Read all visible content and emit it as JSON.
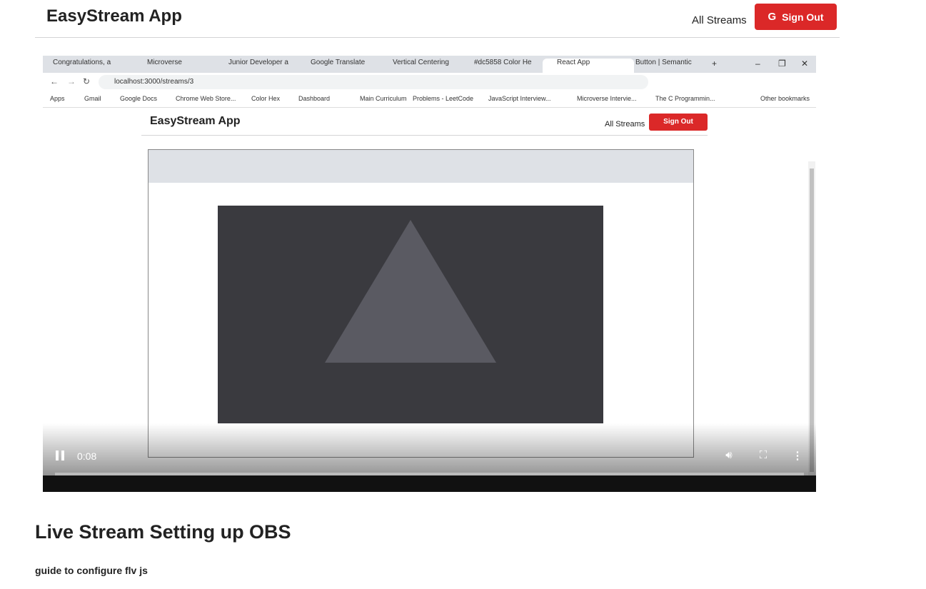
{
  "header": {
    "brand": "EasyStream App",
    "nav_all_streams": "All Streams",
    "sign_out_label": "Sign Out",
    "sign_out_icon": "G"
  },
  "captured_browser": {
    "tabs": [
      {
        "label": "Congratulations, a"
      },
      {
        "label": "Microverse"
      },
      {
        "label": "Junior Developer a"
      },
      {
        "label": "Google Translate"
      },
      {
        "label": "Vertical Centering"
      },
      {
        "label": "#dc5858 Color He"
      },
      {
        "label": "React App"
      },
      {
        "label": "Button | Semantic"
      }
    ],
    "url": "localhost:3000/streams/3",
    "bookmarks": [
      "Apps",
      "Gmail",
      "Google Docs",
      "Chrome Web Store...",
      "Color Hex",
      "Dashboard",
      "Main Curriculum",
      "Problems - LeetCode",
      "JavaScript Interview...",
      "Microverse Intervie...",
      "The C Programmin...",
      "Other bookmarks"
    ],
    "inner_brand": "EasyStream App",
    "inner_all_streams": "All Streams",
    "inner_sign_out": "Sign Out"
  },
  "player": {
    "current_time": "0:08",
    "progress": 0.0,
    "pause_icon": "pause-icon",
    "volume_icon": "volume-icon",
    "fullscreen_icon": "fullscreen-icon",
    "more_icon": "more-vert-icon"
  },
  "stream": {
    "title": "Live Stream Setting up OBS",
    "description": "guide to configure flv js"
  },
  "colors": {
    "accent": "#db2828"
  }
}
